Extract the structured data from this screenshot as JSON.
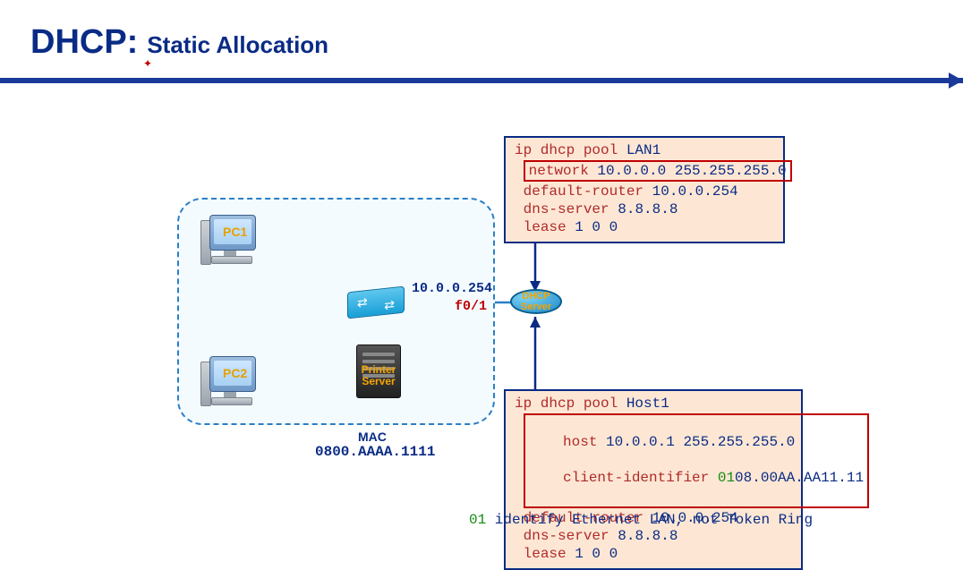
{
  "title": {
    "big": "DHCP:",
    "small": "Static Allocation"
  },
  "pc1_label": "PC1",
  "pc2_label": "PC2",
  "printer_label_l1": "Printer",
  "printer_label_l2": "Server",
  "router_label_l1": "DHCP",
  "router_label_l2": "Server",
  "ip_label": "10.0.0.254",
  "port_label": "f0/1",
  "mac_title": "MAC",
  "mac_value": "0800.AAAA.1111",
  "config1": {
    "line1_kw": "ip dhcp pool ",
    "line1_arg": "LAN1",
    "hl_kw": "network ",
    "hl_arg": "10.0.0.0 255.255.255.0",
    "line3_kw": "default-router ",
    "line3_arg": "10.0.0.254",
    "line4_kw": "dns-server ",
    "line4_arg": "8.8.8.8",
    "line5_kw": "lease ",
    "line5_arg": "1 0 0"
  },
  "config2": {
    "line1_kw": "ip dhcp pool ",
    "line1_arg": "Host1",
    "hl1_kw": "host ",
    "hl1_arg": "10.0.0.1 255.255.255.0",
    "hl2_kw": "client-identifier ",
    "hl2_grn": "01",
    "hl2_arg": "08.00AA.AA11.11",
    "line4_kw": "default-router ",
    "line4_arg": "10.0.0.254",
    "line5_kw": "dns-server ",
    "line5_arg": "8.8.8.8",
    "line6_kw": "lease ",
    "line6_arg": "1 0 0"
  },
  "footnote_grn": "01",
  "footnote_rest": " identify Ethernet LAN, not Token Ring"
}
